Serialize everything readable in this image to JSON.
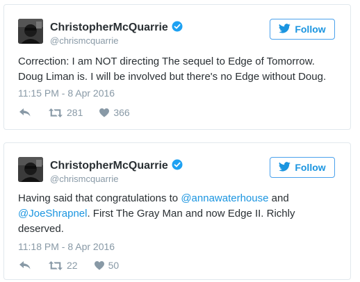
{
  "colors": {
    "brand_blue": "#1b95e0",
    "text": "#292f33",
    "muted": "#8899a6",
    "border": "#e1e8ed"
  },
  "tweets": [
    {
      "display_name": "ChristopherMcQuarrie",
      "handle": "@chrismcquarrie",
      "follow_label": "Follow",
      "text_lines": [
        "Correction: I am NOT directing The sequel to Edge of Tomorrow.",
        "Doug Liman is. I will be involved but there's no Edge without Doug."
      ],
      "timestamp": "11:15 PM - 8 Apr 2016",
      "retweets": "281",
      "likes": "366",
      "icons": [
        "avatar-photo",
        "verified-badge-icon",
        "twitter-bird-icon",
        "reply-icon",
        "retweet-icon",
        "heart-icon"
      ]
    },
    {
      "display_name": "ChristopherMcQuarrie",
      "handle": "@chrismcquarrie",
      "follow_label": "Follow",
      "text_parts": {
        "p1": "Having said that congratulations to ",
        "mention1": "@annawaterhouse",
        "p2": " and",
        "mention2": "@JoeShrapnel",
        "p3": ". First The Gray Man and now Edge II. Richly",
        "p4": "deserved."
      },
      "timestamp": "11:18 PM - 8 Apr 2016",
      "retweets": "22",
      "likes": "50",
      "icons": [
        "avatar-photo",
        "verified-badge-icon",
        "twitter-bird-icon",
        "reply-icon",
        "retweet-icon",
        "heart-icon"
      ]
    }
  ]
}
